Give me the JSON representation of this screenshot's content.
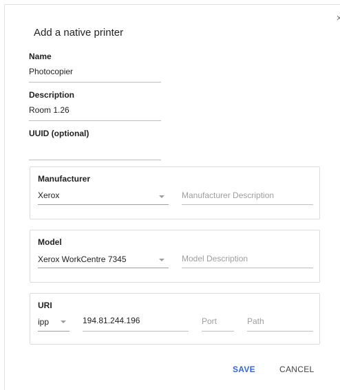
{
  "dialog": {
    "title": "Add a native printer",
    "close_glyph": "×"
  },
  "fields": {
    "name": {
      "label": "Name",
      "value": "Photocopier"
    },
    "description": {
      "label": "Description",
      "value": "Room 1.26"
    },
    "uuid": {
      "label": "UUID (optional)",
      "value": ""
    }
  },
  "manufacturer": {
    "label": "Manufacturer",
    "selected": "Xerox",
    "description_placeholder": "Manufacturer Description"
  },
  "model": {
    "label": "Model",
    "selected": "Xerox WorkCentre 7345",
    "description_placeholder": "Model Description"
  },
  "uri": {
    "label": "URI",
    "protocol": "ipp",
    "address": "194.81.244.196",
    "port_placeholder": "Port",
    "path_placeholder": "Path"
  },
  "actions": {
    "save_label": "SAVE",
    "cancel_label": "CANCEL"
  },
  "colors": {
    "accent": "#3367d6",
    "text": "#212121",
    "placeholder": "#9e9e9e"
  }
}
